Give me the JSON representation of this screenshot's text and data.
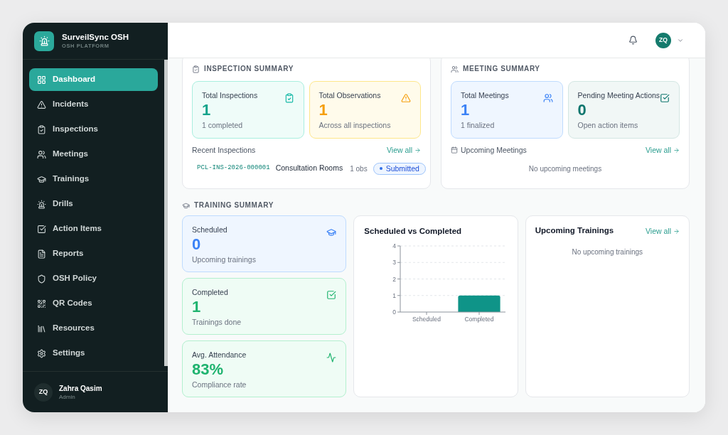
{
  "sidebar": {
    "brand": {
      "title": "SurveilSync OSH",
      "subtitle": "OSH PLATFORM"
    },
    "items": [
      {
        "label": "Dashboard",
        "selected": true
      },
      {
        "label": "Incidents",
        "selected": false
      },
      {
        "label": "Inspections",
        "selected": false
      },
      {
        "label": "Meetings",
        "selected": false
      },
      {
        "label": "Trainings",
        "selected": false
      },
      {
        "label": "Drills",
        "selected": false
      },
      {
        "label": "Action Items",
        "selected": false
      },
      {
        "label": "Reports",
        "selected": false
      },
      {
        "label": "OSH Policy",
        "selected": false
      },
      {
        "label": "QR Codes",
        "selected": false
      },
      {
        "label": "Resources",
        "selected": false
      },
      {
        "label": "Settings",
        "selected": false
      }
    ],
    "user": {
      "initials": "ZQ",
      "name": "Zahra Qasim",
      "role": "Admin"
    }
  },
  "topbar": {
    "avatar_initials": "ZQ"
  },
  "inspection_summary": {
    "title": "INSPECTION SUMMARY",
    "stats": [
      {
        "kind": "teal",
        "label": "Total Inspections",
        "value": "1",
        "note": "1 completed"
      },
      {
        "kind": "amber",
        "label": "Total Observations",
        "value": "1",
        "note": "Across all inspections"
      }
    ],
    "list_title": "Recent Inspections",
    "link": "View all",
    "rows": [
      {
        "code": "PCL-INS-2026-000001",
        "location": "Consultation Rooms",
        "observations": "1 obs",
        "status": "Submitted"
      }
    ]
  },
  "meeting_summary": {
    "title": "MEETING SUMMARY",
    "stats": [
      {
        "kind": "blue",
        "label": "Total Meetings",
        "value": "1",
        "note": "1 finalized"
      },
      {
        "kind": "slate",
        "label": "Pending Meeting Actions",
        "value": "0",
        "note": "Open action items"
      }
    ],
    "list_title": "Upcoming Meetings",
    "link": "View all",
    "empty": "No upcoming meetings"
  },
  "training_summary": {
    "title": "TRAINING SUMMARY",
    "stats": [
      {
        "kind": "blue",
        "label": "Scheduled",
        "value": "0",
        "note": "Upcoming trainings"
      },
      {
        "kind": "green",
        "label": "Completed",
        "value": "1",
        "note": "Trainings done"
      },
      {
        "kind": "green",
        "label": "Avg. Attendance",
        "value": "83%",
        "note": "Compliance rate"
      }
    ],
    "chart": {
      "chart_data": {
        "type": "bar",
        "title": "Scheduled vs Completed",
        "categories": [
          "Scheduled",
          "Completed"
        ],
        "values": [
          0,
          1
        ],
        "ylim": [
          0,
          4
        ],
        "yticks": [
          0,
          1,
          2,
          3,
          4
        ],
        "grid": true
      }
    },
    "upcoming": {
      "title": "Upcoming Trainings",
      "link": "View all",
      "empty": "No upcoming trainings"
    }
  }
}
